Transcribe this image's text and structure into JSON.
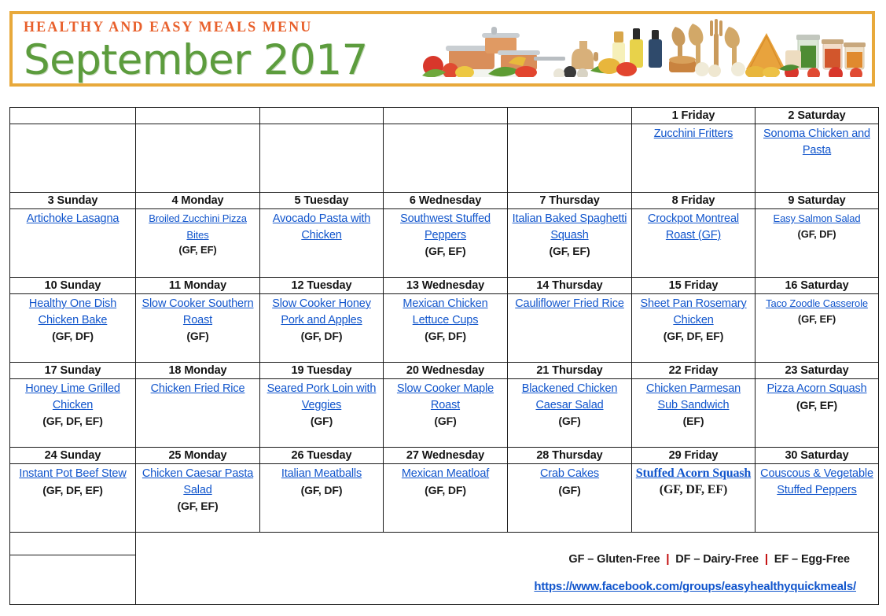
{
  "banner": {
    "kicker": "HEALTHY AND EASY MEALS MENU",
    "title": "September 2017",
    "border_color": "#E8A93B",
    "kicker_color": "#E8602C",
    "title_color": "#5C9C3D",
    "artwork": "food-and-cookware-photo"
  },
  "calendar": {
    "weeks": [
      {
        "days": [
          {
            "label": "",
            "meals": []
          },
          {
            "label": "",
            "meals": []
          },
          {
            "label": "",
            "meals": []
          },
          {
            "label": "",
            "meals": []
          },
          {
            "label": "",
            "meals": []
          },
          {
            "label": "1 Friday",
            "meals": [
              {
                "name": "Zucchini Fritters",
                "tags": ""
              }
            ]
          },
          {
            "label": "2 Saturday",
            "meals": [
              {
                "name": "Sonoma Chicken and Pasta",
                "tags": ""
              }
            ]
          }
        ]
      },
      {
        "days": [
          {
            "label": "3 Sunday",
            "meals": [
              {
                "name": "Artichoke Lasagna",
                "tags": ""
              }
            ]
          },
          {
            "label": "4 Monday",
            "meals": [
              {
                "name": "Broiled Zucchini Pizza Bites",
                "tags": "(GF, EF)"
              }
            ],
            "size": "small"
          },
          {
            "label": "5 Tuesday",
            "meals": [
              {
                "name": "Avocado Pasta with Chicken",
                "tags": ""
              }
            ]
          },
          {
            "label": "6 Wednesday",
            "meals": [
              {
                "name": "Southwest Stuffed Peppers",
                "tags": "(GF, EF)"
              }
            ]
          },
          {
            "label": "7 Thursday",
            "meals": [
              {
                "name": "Italian Baked Spaghetti Squash",
                "tags": "(GF, EF)"
              }
            ]
          },
          {
            "label": "8 Friday",
            "meals": [
              {
                "name": "Crockpot Montreal Roast  (GF)",
                "tags": ""
              }
            ]
          },
          {
            "label": "9 Saturday",
            "meals": [
              {
                "name": "Easy Salmon Salad",
                "tags": "(GF, DF)"
              }
            ],
            "size": "small"
          }
        ]
      },
      {
        "days": [
          {
            "label": "10 Sunday",
            "meals": [
              {
                "name": "Healthy One Dish Chicken Bake",
                "tags": "(GF, DF)"
              }
            ]
          },
          {
            "label": "11 Monday",
            "meals": [
              {
                "name": "Slow Cooker Southern Roast",
                "tags": "(GF)"
              }
            ]
          },
          {
            "label": "12 Tuesday",
            "meals": [
              {
                "name": "Slow Cooker Honey Pork and Apples",
                "tags": "(GF, DF)"
              }
            ]
          },
          {
            "label": "13 Wednesday",
            "meals": [
              {
                "name": "Mexican Chicken Lettuce Cups",
                "tags": "(GF, DF)"
              }
            ]
          },
          {
            "label": "14 Thursday",
            "meals": [
              {
                "name": "Cauliflower Fried Rice",
                "tags": ""
              }
            ]
          },
          {
            "label": "15 Friday",
            "meals": [
              {
                "name": "Sheet Pan Rosemary Chicken",
                "tags": "(GF, DF, EF)"
              }
            ]
          },
          {
            "label": "16 Saturday",
            "meals": [
              {
                "name": "Taco Zoodle Casserole",
                "tags": "(GF, EF)"
              }
            ],
            "size": "small"
          }
        ]
      },
      {
        "days": [
          {
            "label": "17 Sunday",
            "meals": [
              {
                "name": "Honey Lime Grilled Chicken",
                "tags": "(GF, DF, EF)"
              }
            ]
          },
          {
            "label": "18 Monday",
            "meals": [
              {
                "name": "Chicken Fried Rice",
                "tags": ""
              }
            ]
          },
          {
            "label": "19 Tuesday",
            "meals": [
              {
                "name": "Seared Pork Loin with Veggies",
                "tags": "(GF)"
              }
            ]
          },
          {
            "label": "20 Wednesday",
            "meals": [
              {
                "name": "Slow Cooker Maple Roast",
                "tags": "(GF)"
              }
            ]
          },
          {
            "label": "21 Thursday",
            "meals": [
              {
                "name": "Blackened Chicken Caesar Salad",
                "tags": "(GF)"
              }
            ]
          },
          {
            "label": "22 Friday",
            "meals": [
              {
                "name": "Chicken Parmesan Sub Sandwich",
                "tags": "(EF)"
              }
            ]
          },
          {
            "label": "23 Saturday",
            "meals": [
              {
                "name": "Pizza Acorn Squash",
                "tags": "(GF, EF)"
              }
            ]
          }
        ]
      },
      {
        "days": [
          {
            "label": "24 Sunday",
            "meals": [
              {
                "name": "Instant Pot Beef Stew",
                "tags": "(GF, DF, EF)"
              }
            ]
          },
          {
            "label": "25 Monday",
            "meals": [
              {
                "name": "Chicken Caesar Pasta Salad",
                "tags": "(GF, EF)"
              }
            ]
          },
          {
            "label": "26 Tuesday",
            "meals": [
              {
                "name": "Italian Meatballs",
                "tags": "(GF, DF)"
              }
            ]
          },
          {
            "label": "27 Wednesday",
            "meals": [
              {
                "name": "Mexican Meatloaf",
                "tags": "(GF, DF)"
              }
            ]
          },
          {
            "label": "28 Thursday",
            "meals": [
              {
                "name": "Crab Cakes",
                "tags": "(GF)"
              }
            ]
          },
          {
            "label": "29 Friday",
            "meals": [
              {
                "name": "Stuffed Acorn Squash",
                "tags": "(GF, DF, EF)"
              }
            ],
            "font": "serif"
          },
          {
            "label": "30 Saturday",
            "meals": [
              {
                "name": "Couscous & Vegetable Stuffed Peppers",
                "tags": ""
              }
            ]
          }
        ]
      }
    ]
  },
  "footer": {
    "legend": {
      "gf": "GF – Gluten-Free",
      "df": "DF – Dairy-Free",
      "ef": "EF – Egg-Free",
      "separator": "|"
    },
    "facebook_url": "https://www.facebook.com/groups/easyhealthyquickmeals/"
  }
}
